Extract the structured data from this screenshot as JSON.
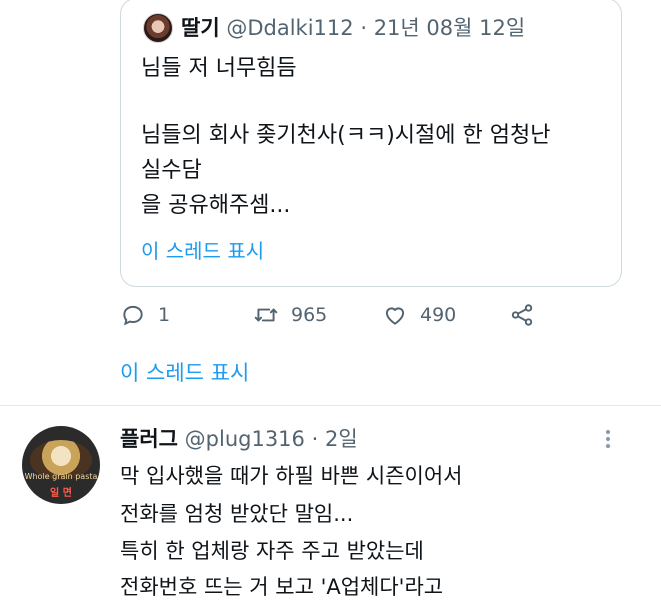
{
  "quoted_tweet": {
    "name": "딸기",
    "handle": "@Ddalki112",
    "separator": "·",
    "date": "21년 08월 12일",
    "lines": [
      "님들 저 너무힘듬",
      "님들의 회사 좆기천사(ㅋㅋ)시절에 한 엄청난",
      "실수담",
      "을 공유해주셈..."
    ],
    "show_thread": "이 스레드 표시"
  },
  "actions": {
    "reply_icon": "reply-icon",
    "reply_count": "1",
    "retweet_icon": "retweet-icon",
    "retweet_count": "965",
    "like_icon": "heart-icon",
    "like_count": "490",
    "share_icon": "share-icon"
  },
  "thread_link": "이 스레드 표시",
  "reply_tweet": {
    "name": "플러그",
    "handle": "@plug1316",
    "separator": "·",
    "time": "2일",
    "avatar_caption_1": "Whole grain pasta",
    "avatar_caption_2": "일 면",
    "lines": [
      "막 입사했을 때가 하필 바쁜 시즌이어서",
      "전화를 엄청 받았단 말임...",
      "특히 한 업체랑 자주 주고 받았는데",
      "전화번호 뜨는 거 보고 'A업체다'라고"
    ]
  },
  "colors": {
    "accent": "#1d9bf0",
    "text": "#0f1419",
    "secondary": "#536471",
    "border": "#cfd9de"
  }
}
